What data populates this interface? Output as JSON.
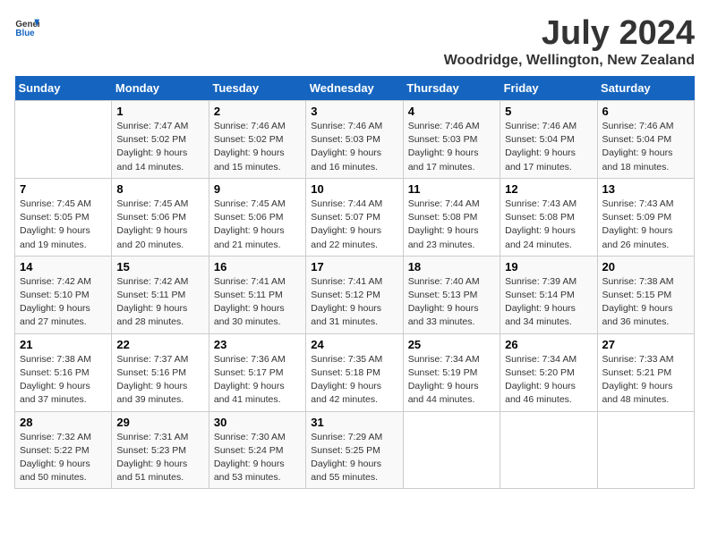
{
  "header": {
    "logo_general": "General",
    "logo_blue": "Blue",
    "title": "July 2024",
    "subtitle": "Woodridge, Wellington, New Zealand"
  },
  "calendar": {
    "weekdays": [
      "Sunday",
      "Monday",
      "Tuesday",
      "Wednesday",
      "Thursday",
      "Friday",
      "Saturday"
    ],
    "weeks": [
      [
        {
          "day": "",
          "sunrise": "",
          "sunset": "",
          "daylight": ""
        },
        {
          "day": "1",
          "sunrise": "Sunrise: 7:47 AM",
          "sunset": "Sunset: 5:02 PM",
          "daylight": "Daylight: 9 hours and 14 minutes."
        },
        {
          "day": "2",
          "sunrise": "Sunrise: 7:46 AM",
          "sunset": "Sunset: 5:02 PM",
          "daylight": "Daylight: 9 hours and 15 minutes."
        },
        {
          "day": "3",
          "sunrise": "Sunrise: 7:46 AM",
          "sunset": "Sunset: 5:03 PM",
          "daylight": "Daylight: 9 hours and 16 minutes."
        },
        {
          "day": "4",
          "sunrise": "Sunrise: 7:46 AM",
          "sunset": "Sunset: 5:03 PM",
          "daylight": "Daylight: 9 hours and 17 minutes."
        },
        {
          "day": "5",
          "sunrise": "Sunrise: 7:46 AM",
          "sunset": "Sunset: 5:04 PM",
          "daylight": "Daylight: 9 hours and 17 minutes."
        },
        {
          "day": "6",
          "sunrise": "Sunrise: 7:46 AM",
          "sunset": "Sunset: 5:04 PM",
          "daylight": "Daylight: 9 hours and 18 minutes."
        }
      ],
      [
        {
          "day": "7",
          "sunrise": "Sunrise: 7:45 AM",
          "sunset": "Sunset: 5:05 PM",
          "daylight": "Daylight: 9 hours and 19 minutes."
        },
        {
          "day": "8",
          "sunrise": "Sunrise: 7:45 AM",
          "sunset": "Sunset: 5:06 PM",
          "daylight": "Daylight: 9 hours and 20 minutes."
        },
        {
          "day": "9",
          "sunrise": "Sunrise: 7:45 AM",
          "sunset": "Sunset: 5:06 PM",
          "daylight": "Daylight: 9 hours and 21 minutes."
        },
        {
          "day": "10",
          "sunrise": "Sunrise: 7:44 AM",
          "sunset": "Sunset: 5:07 PM",
          "daylight": "Daylight: 9 hours and 22 minutes."
        },
        {
          "day": "11",
          "sunrise": "Sunrise: 7:44 AM",
          "sunset": "Sunset: 5:08 PM",
          "daylight": "Daylight: 9 hours and 23 minutes."
        },
        {
          "day": "12",
          "sunrise": "Sunrise: 7:43 AM",
          "sunset": "Sunset: 5:08 PM",
          "daylight": "Daylight: 9 hours and 24 minutes."
        },
        {
          "day": "13",
          "sunrise": "Sunrise: 7:43 AM",
          "sunset": "Sunset: 5:09 PM",
          "daylight": "Daylight: 9 hours and 26 minutes."
        }
      ],
      [
        {
          "day": "14",
          "sunrise": "Sunrise: 7:42 AM",
          "sunset": "Sunset: 5:10 PM",
          "daylight": "Daylight: 9 hours and 27 minutes."
        },
        {
          "day": "15",
          "sunrise": "Sunrise: 7:42 AM",
          "sunset": "Sunset: 5:11 PM",
          "daylight": "Daylight: 9 hours and 28 minutes."
        },
        {
          "day": "16",
          "sunrise": "Sunrise: 7:41 AM",
          "sunset": "Sunset: 5:11 PM",
          "daylight": "Daylight: 9 hours and 30 minutes."
        },
        {
          "day": "17",
          "sunrise": "Sunrise: 7:41 AM",
          "sunset": "Sunset: 5:12 PM",
          "daylight": "Daylight: 9 hours and 31 minutes."
        },
        {
          "day": "18",
          "sunrise": "Sunrise: 7:40 AM",
          "sunset": "Sunset: 5:13 PM",
          "daylight": "Daylight: 9 hours and 33 minutes."
        },
        {
          "day": "19",
          "sunrise": "Sunrise: 7:39 AM",
          "sunset": "Sunset: 5:14 PM",
          "daylight": "Daylight: 9 hours and 34 minutes."
        },
        {
          "day": "20",
          "sunrise": "Sunrise: 7:38 AM",
          "sunset": "Sunset: 5:15 PM",
          "daylight": "Daylight: 9 hours and 36 minutes."
        }
      ],
      [
        {
          "day": "21",
          "sunrise": "Sunrise: 7:38 AM",
          "sunset": "Sunset: 5:16 PM",
          "daylight": "Daylight: 9 hours and 37 minutes."
        },
        {
          "day": "22",
          "sunrise": "Sunrise: 7:37 AM",
          "sunset": "Sunset: 5:16 PM",
          "daylight": "Daylight: 9 hours and 39 minutes."
        },
        {
          "day": "23",
          "sunrise": "Sunrise: 7:36 AM",
          "sunset": "Sunset: 5:17 PM",
          "daylight": "Daylight: 9 hours and 41 minutes."
        },
        {
          "day": "24",
          "sunrise": "Sunrise: 7:35 AM",
          "sunset": "Sunset: 5:18 PM",
          "daylight": "Daylight: 9 hours and 42 minutes."
        },
        {
          "day": "25",
          "sunrise": "Sunrise: 7:34 AM",
          "sunset": "Sunset: 5:19 PM",
          "daylight": "Daylight: 9 hours and 44 minutes."
        },
        {
          "day": "26",
          "sunrise": "Sunrise: 7:34 AM",
          "sunset": "Sunset: 5:20 PM",
          "daylight": "Daylight: 9 hours and 46 minutes."
        },
        {
          "day": "27",
          "sunrise": "Sunrise: 7:33 AM",
          "sunset": "Sunset: 5:21 PM",
          "daylight": "Daylight: 9 hours and 48 minutes."
        }
      ],
      [
        {
          "day": "28",
          "sunrise": "Sunrise: 7:32 AM",
          "sunset": "Sunset: 5:22 PM",
          "daylight": "Daylight: 9 hours and 50 minutes."
        },
        {
          "day": "29",
          "sunrise": "Sunrise: 7:31 AM",
          "sunset": "Sunset: 5:23 PM",
          "daylight": "Daylight: 9 hours and 51 minutes."
        },
        {
          "day": "30",
          "sunrise": "Sunrise: 7:30 AM",
          "sunset": "Sunset: 5:24 PM",
          "daylight": "Daylight: 9 hours and 53 minutes."
        },
        {
          "day": "31",
          "sunrise": "Sunrise: 7:29 AM",
          "sunset": "Sunset: 5:25 PM",
          "daylight": "Daylight: 9 hours and 55 minutes."
        },
        {
          "day": "",
          "sunrise": "",
          "sunset": "",
          "daylight": ""
        },
        {
          "day": "",
          "sunrise": "",
          "sunset": "",
          "daylight": ""
        },
        {
          "day": "",
          "sunrise": "",
          "sunset": "",
          "daylight": ""
        }
      ]
    ]
  }
}
